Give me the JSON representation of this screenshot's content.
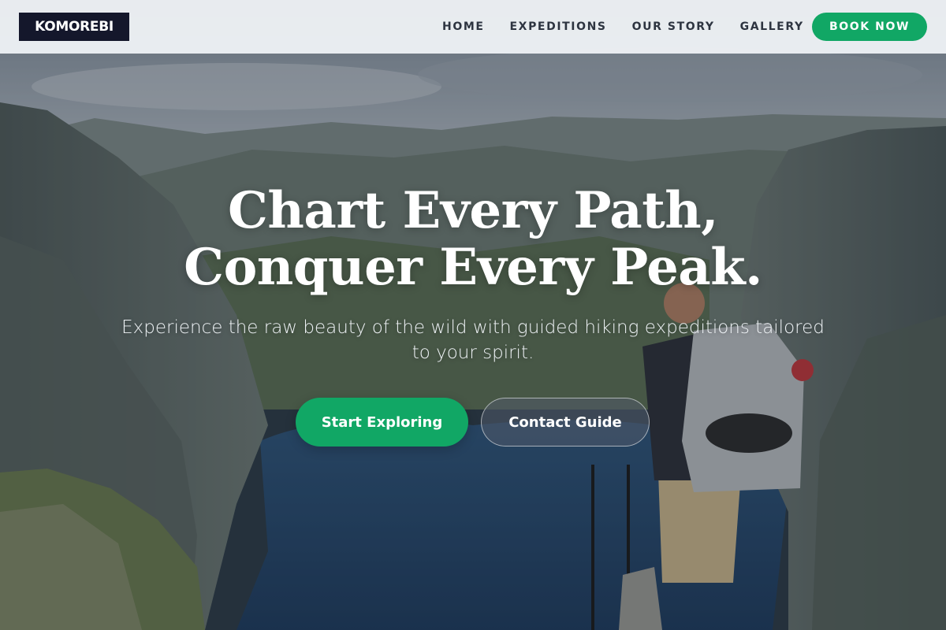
{
  "brand": {
    "logo_text": "KOMOREBI"
  },
  "nav": {
    "links": [
      {
        "label": "HOME"
      },
      {
        "label": "EXPEDITIONS"
      },
      {
        "label": "OUR STORY"
      },
      {
        "label": "GALLERY"
      }
    ],
    "cta_label": "BOOK NOW"
  },
  "hero": {
    "title_line1": "Chart Every Path,",
    "title_line2": "Conquer Every Peak.",
    "subtitle": "Experience the raw beauty of the wild with guided hiking expeditions tailored to your spirit.",
    "primary_button": "Start Exploring",
    "secondary_button": "Contact Guide"
  },
  "colors": {
    "accent_green": "#11a765",
    "logo_bg": "#14172b",
    "nav_text": "#2d3440"
  }
}
